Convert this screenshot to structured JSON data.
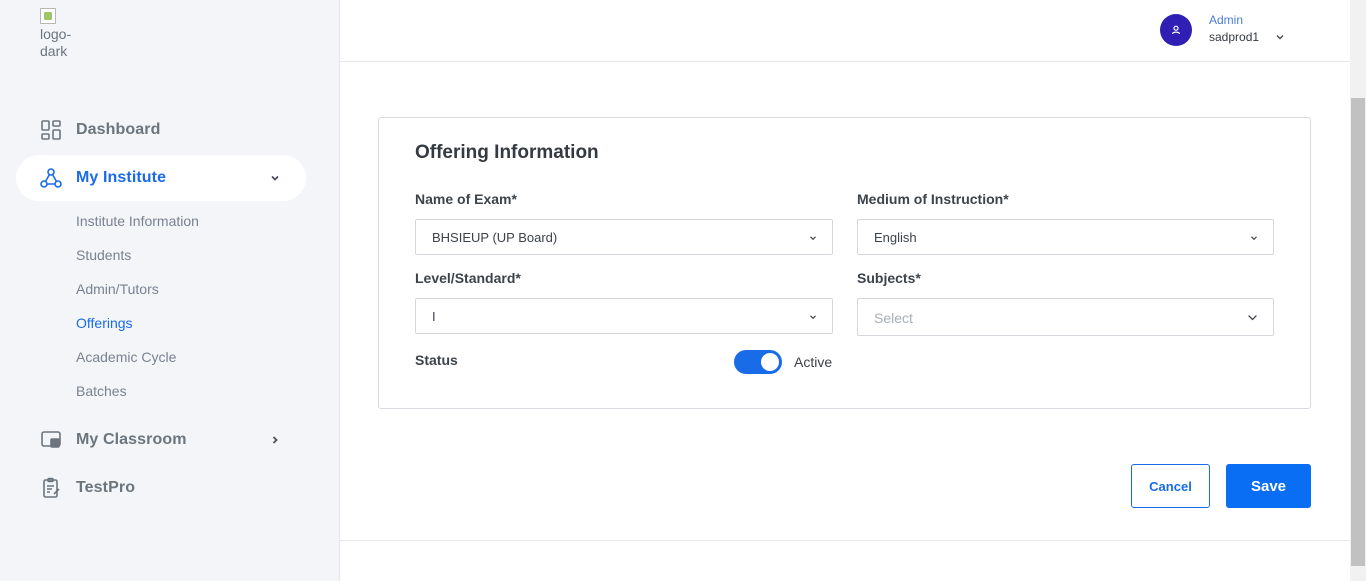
{
  "logo": {
    "alt_text": "logo-dark"
  },
  "sidebar": {
    "items": [
      {
        "label": "Dashboard",
        "icon": "dashboard-icon"
      },
      {
        "label": "My Institute",
        "icon": "institute-icon",
        "expanded": true
      },
      {
        "label": "My Classroom",
        "icon": "classroom-icon"
      },
      {
        "label": "TestPro",
        "icon": "testpro-icon"
      }
    ],
    "institute_sub_items": [
      {
        "label": "Institute Information"
      },
      {
        "label": "Students"
      },
      {
        "label": "Admin/Tutors"
      },
      {
        "label": "Offerings",
        "active": true
      },
      {
        "label": "Academic Cycle"
      },
      {
        "label": "Batches"
      }
    ]
  },
  "header": {
    "user_role": "Admin",
    "user_name": "sadprod1"
  },
  "form": {
    "title": "Offering Information",
    "exam_label": "Name of Exam*",
    "exam_value": "BHSIEUP (UP Board)",
    "medium_label": "Medium of Instruction*",
    "medium_value": "English",
    "level_label": "Level/Standard*",
    "level_value": "I",
    "subjects_label": "Subjects*",
    "subjects_placeholder": "Select",
    "status_label": "Status",
    "status_value": "Active",
    "status_on": true
  },
  "actions": {
    "cancel_label": "Cancel",
    "save_label": "Save"
  },
  "colors": {
    "accent": "#1a6be8",
    "save_button": "#0a6ef5",
    "avatar": "#2f1fb5",
    "sidebar_bg": "#f3f5f9"
  }
}
